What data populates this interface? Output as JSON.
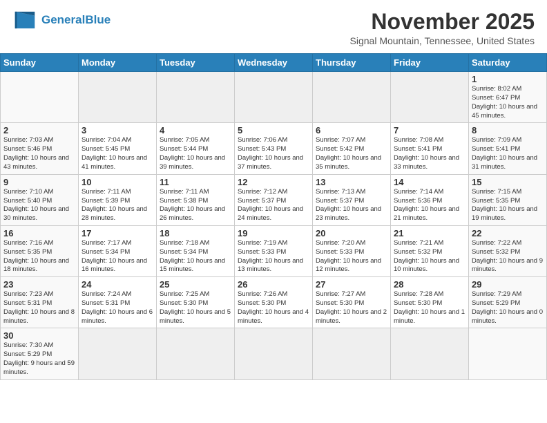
{
  "header": {
    "logo_general": "General",
    "logo_blue": "Blue",
    "month_title": "November 2025",
    "location": "Signal Mountain, Tennessee, United States"
  },
  "days_of_week": [
    "Sunday",
    "Monday",
    "Tuesday",
    "Wednesday",
    "Thursday",
    "Friday",
    "Saturday"
  ],
  "weeks": [
    [
      {
        "day": "",
        "empty": true
      },
      {
        "day": "",
        "empty": true
      },
      {
        "day": "",
        "empty": true
      },
      {
        "day": "",
        "empty": true
      },
      {
        "day": "",
        "empty": true
      },
      {
        "day": "",
        "empty": true
      },
      {
        "day": "1",
        "info": "Sunrise: 8:02 AM\nSunset: 6:47 PM\nDaylight: 10 hours and 45 minutes."
      }
    ],
    [
      {
        "day": "2",
        "info": "Sunrise: 7:03 AM\nSunset: 5:46 PM\nDaylight: 10 hours and 43 minutes."
      },
      {
        "day": "3",
        "info": "Sunrise: 7:04 AM\nSunset: 5:45 PM\nDaylight: 10 hours and 41 minutes."
      },
      {
        "day": "4",
        "info": "Sunrise: 7:05 AM\nSunset: 5:44 PM\nDaylight: 10 hours and 39 minutes."
      },
      {
        "day": "5",
        "info": "Sunrise: 7:06 AM\nSunset: 5:43 PM\nDaylight: 10 hours and 37 minutes."
      },
      {
        "day": "6",
        "info": "Sunrise: 7:07 AM\nSunset: 5:42 PM\nDaylight: 10 hours and 35 minutes."
      },
      {
        "day": "7",
        "info": "Sunrise: 7:08 AM\nSunset: 5:41 PM\nDaylight: 10 hours and 33 minutes."
      },
      {
        "day": "8",
        "info": "Sunrise: 7:09 AM\nSunset: 5:41 PM\nDaylight: 10 hours and 31 minutes."
      }
    ],
    [
      {
        "day": "9",
        "info": "Sunrise: 7:10 AM\nSunset: 5:40 PM\nDaylight: 10 hours and 30 minutes."
      },
      {
        "day": "10",
        "info": "Sunrise: 7:11 AM\nSunset: 5:39 PM\nDaylight: 10 hours and 28 minutes."
      },
      {
        "day": "11",
        "info": "Sunrise: 7:11 AM\nSunset: 5:38 PM\nDaylight: 10 hours and 26 minutes."
      },
      {
        "day": "12",
        "info": "Sunrise: 7:12 AM\nSunset: 5:37 PM\nDaylight: 10 hours and 24 minutes."
      },
      {
        "day": "13",
        "info": "Sunrise: 7:13 AM\nSunset: 5:37 PM\nDaylight: 10 hours and 23 minutes."
      },
      {
        "day": "14",
        "info": "Sunrise: 7:14 AM\nSunset: 5:36 PM\nDaylight: 10 hours and 21 minutes."
      },
      {
        "day": "15",
        "info": "Sunrise: 7:15 AM\nSunset: 5:35 PM\nDaylight: 10 hours and 19 minutes."
      }
    ],
    [
      {
        "day": "16",
        "info": "Sunrise: 7:16 AM\nSunset: 5:35 PM\nDaylight: 10 hours and 18 minutes."
      },
      {
        "day": "17",
        "info": "Sunrise: 7:17 AM\nSunset: 5:34 PM\nDaylight: 10 hours and 16 minutes."
      },
      {
        "day": "18",
        "info": "Sunrise: 7:18 AM\nSunset: 5:34 PM\nDaylight: 10 hours and 15 minutes."
      },
      {
        "day": "19",
        "info": "Sunrise: 7:19 AM\nSunset: 5:33 PM\nDaylight: 10 hours and 13 minutes."
      },
      {
        "day": "20",
        "info": "Sunrise: 7:20 AM\nSunset: 5:33 PM\nDaylight: 10 hours and 12 minutes."
      },
      {
        "day": "21",
        "info": "Sunrise: 7:21 AM\nSunset: 5:32 PM\nDaylight: 10 hours and 10 minutes."
      },
      {
        "day": "22",
        "info": "Sunrise: 7:22 AM\nSunset: 5:32 PM\nDaylight: 10 hours and 9 minutes."
      }
    ],
    [
      {
        "day": "23",
        "info": "Sunrise: 7:23 AM\nSunset: 5:31 PM\nDaylight: 10 hours and 8 minutes."
      },
      {
        "day": "24",
        "info": "Sunrise: 7:24 AM\nSunset: 5:31 PM\nDaylight: 10 hours and 6 minutes."
      },
      {
        "day": "25",
        "info": "Sunrise: 7:25 AM\nSunset: 5:30 PM\nDaylight: 10 hours and 5 minutes."
      },
      {
        "day": "26",
        "info": "Sunrise: 7:26 AM\nSunset: 5:30 PM\nDaylight: 10 hours and 4 minutes."
      },
      {
        "day": "27",
        "info": "Sunrise: 7:27 AM\nSunset: 5:30 PM\nDaylight: 10 hours and 2 minutes."
      },
      {
        "day": "28",
        "info": "Sunrise: 7:28 AM\nSunset: 5:30 PM\nDaylight: 10 hours and 1 minute."
      },
      {
        "day": "29",
        "info": "Sunrise: 7:29 AM\nSunset: 5:29 PM\nDaylight: 10 hours and 0 minutes."
      }
    ],
    [
      {
        "day": "30",
        "info": "Sunrise: 7:30 AM\nSunset: 5:29 PM\nDaylight: 9 hours and 59 minutes."
      },
      {
        "day": "",
        "empty": true
      },
      {
        "day": "",
        "empty": true
      },
      {
        "day": "",
        "empty": true
      },
      {
        "day": "",
        "empty": true
      },
      {
        "day": "",
        "empty": true
      },
      {
        "day": "",
        "empty": true
      }
    ]
  ]
}
